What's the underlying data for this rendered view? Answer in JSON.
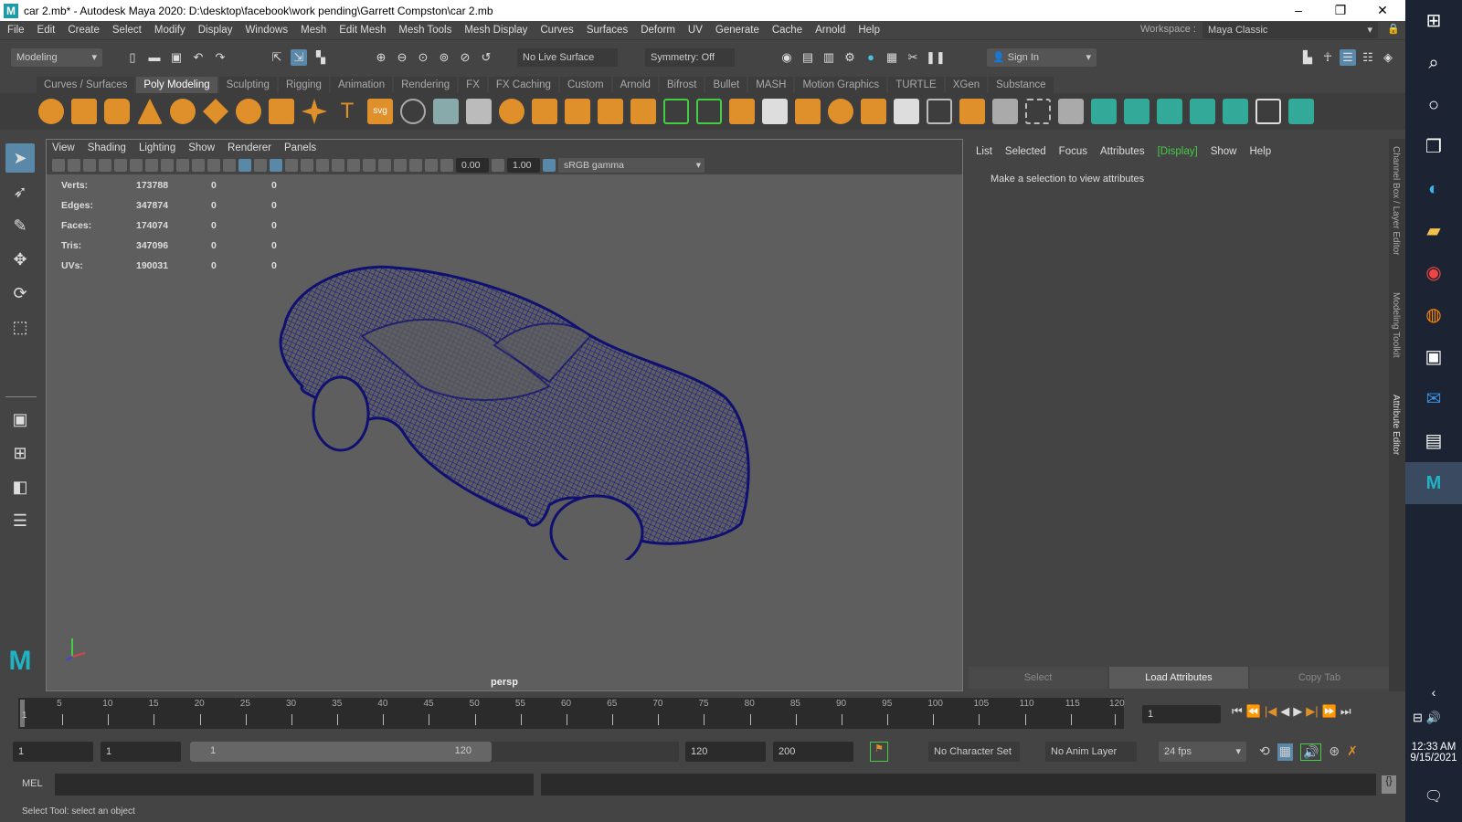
{
  "title": "car 2.mb* - Autodesk Maya 2020: D:\\desktop\\facebook\\work pending\\Garrett Compston\\car 2.mb",
  "menus": [
    "File",
    "Edit",
    "Create",
    "Select",
    "Modify",
    "Display",
    "Windows",
    "Mesh",
    "Edit Mesh",
    "Mesh Tools",
    "Mesh Display",
    "Curves",
    "Surfaces",
    "Deform",
    "UV",
    "Generate",
    "Cache",
    "Arnold",
    "Help"
  ],
  "workspace": {
    "label": "Workspace :",
    "value": "Maya Classic"
  },
  "status": {
    "menuset": "Modeling",
    "live_surface": "No Live Surface",
    "symmetry": "Symmetry: Off",
    "sign_in": "Sign In"
  },
  "shelf_tabs": [
    "Curves / Surfaces",
    "Poly Modeling",
    "Sculpting",
    "Rigging",
    "Animation",
    "Rendering",
    "FX",
    "FX Caching",
    "Custom",
    "Arnold",
    "Bifrost",
    "Bullet",
    "MASH",
    "Motion Graphics",
    "TURTLE",
    "XGen",
    "Substance"
  ],
  "active_shelf": "Poly Modeling",
  "panel_menu": [
    "View",
    "Shading",
    "Lighting",
    "Show",
    "Renderer",
    "Panels"
  ],
  "panel_bar": {
    "exposure": "0.00",
    "gamma": "1.00",
    "color_space": "sRGB gamma"
  },
  "hud": [
    {
      "label": "Verts:",
      "v1": "173788",
      "v2": "0",
      "v3": "0"
    },
    {
      "label": "Edges:",
      "v1": "347874",
      "v2": "0",
      "v3": "0"
    },
    {
      "label": "Faces:",
      "v1": "174074",
      "v2": "0",
      "v3": "0"
    },
    {
      "label": "Tris:",
      "v1": "347096",
      "v2": "0",
      "v3": "0"
    },
    {
      "label": "UVs:",
      "v1": "190031",
      "v2": "0",
      "v3": "0"
    }
  ],
  "camera": "persp",
  "channel_box": {
    "menu": [
      "List",
      "Selected",
      "Focus",
      "Attributes",
      "[Display]",
      "Show",
      "Help"
    ],
    "message": "Make a selection to view attributes",
    "buttons": [
      "Select",
      "Load Attributes",
      "Copy Tab"
    ]
  },
  "side_tabs": [
    "Channel Box / Layer Editor",
    "Modeling Toolkit",
    "Attribute Editor"
  ],
  "timeline": {
    "ticks": [
      "5",
      "10",
      "15",
      "20",
      "25",
      "30",
      "35",
      "40",
      "45",
      "50",
      "55",
      "60",
      "65",
      "70",
      "75",
      "80",
      "85",
      "90",
      "95",
      "100",
      "105",
      "110",
      "115",
      "120"
    ],
    "start_label": "1",
    "current_frame": "1"
  },
  "range": {
    "start": "1",
    "playback_start": "1",
    "slider_start": "1",
    "slider_end": "120",
    "playback_end": "120",
    "end": "200",
    "character_set": "No Character Set",
    "anim_layer": "No Anim Layer",
    "fps": "24 fps"
  },
  "mel": {
    "label": "MEL"
  },
  "help_line": "Select Tool: select an object",
  "clock": {
    "time": "12:33 AM",
    "date": "9/15/2021"
  }
}
